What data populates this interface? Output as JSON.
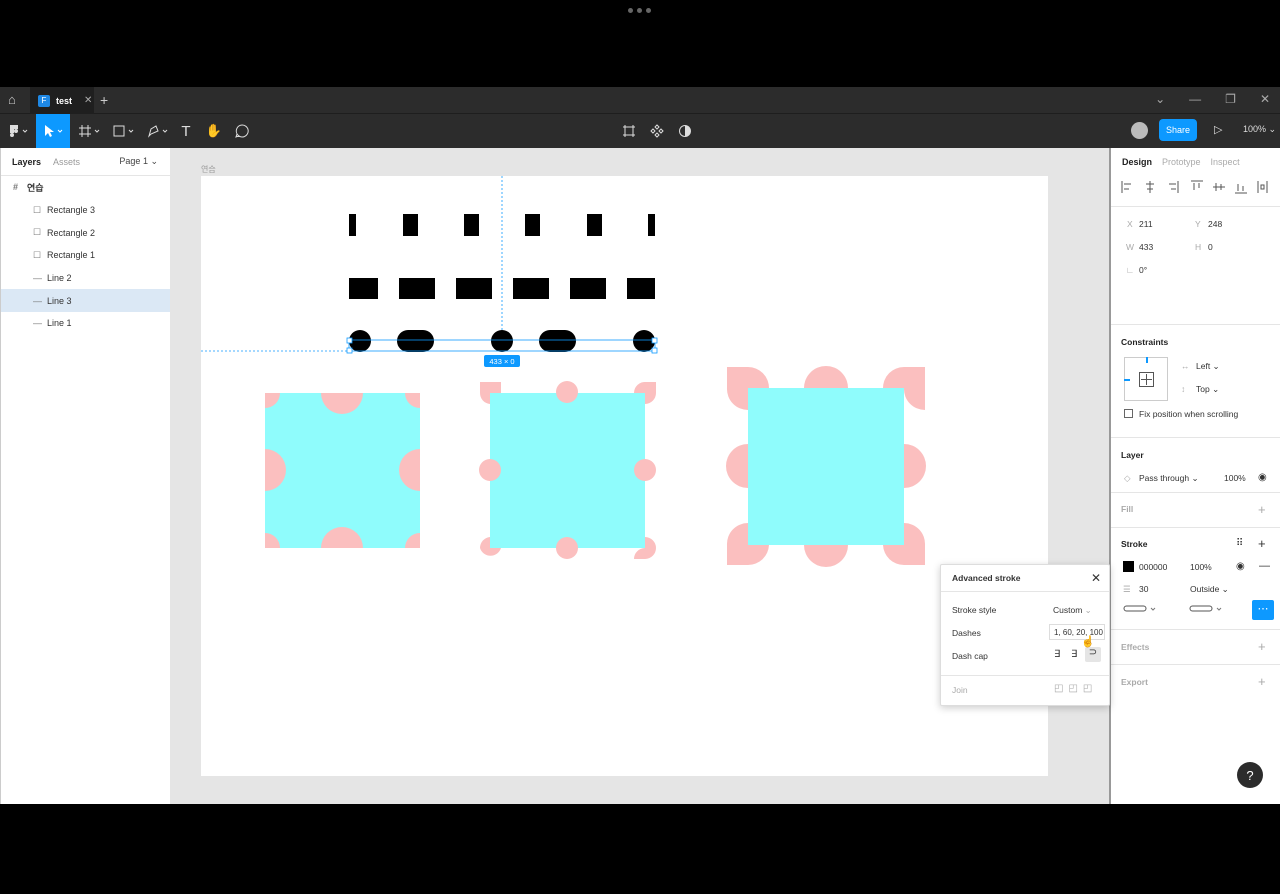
{
  "tabbar": {
    "file_name": "test",
    "file_icon_label": "F"
  },
  "toolbar": {
    "share_label": "Share",
    "zoom_label": "100%"
  },
  "left_panel": {
    "tab_layers": "Layers",
    "tab_assets": "Assets",
    "page_label": "Page 1",
    "frame_name": "연습",
    "layers": [
      {
        "name": "Rectangle 3",
        "icon": "rectangle-icon"
      },
      {
        "name": "Rectangle 2",
        "icon": "rectangle-icon"
      },
      {
        "name": "Rectangle 1",
        "icon": "rectangle-icon"
      },
      {
        "name": "Line 2",
        "icon": "line-icon"
      },
      {
        "name": "Line 3",
        "icon": "line-icon",
        "selected": true
      },
      {
        "name": "Line 1",
        "icon": "line-icon"
      }
    ]
  },
  "canvas": {
    "frame_label": "연습",
    "size_badge": "433 × 0"
  },
  "right_panel": {
    "tab_design": "Design",
    "tab_prototype": "Prototype",
    "tab_inspect": "Inspect",
    "x_label": "X",
    "x_value": "211",
    "y_label": "Y",
    "y_value": "248",
    "w_label": "W",
    "w_value": "433",
    "h_label": "H",
    "h_value": "0",
    "rotation_value": "0°",
    "constraints_title": "Constraints",
    "constraint_h": "Left",
    "constraint_v": "Top",
    "fix_position_label": "Fix position when scrolling",
    "layer_title": "Layer",
    "blend_mode": "Pass through",
    "layer_opacity": "100%",
    "fill_title": "Fill",
    "stroke_title": "Stroke",
    "stroke_color_hex": "000000",
    "stroke_opacity": "100%",
    "stroke_weight": "30",
    "stroke_position": "Outside",
    "effects_title": "Effects",
    "export_title": "Export"
  },
  "advanced_stroke": {
    "title": "Advanced stroke",
    "stroke_style_label": "Stroke style",
    "stroke_style_value": "Custom",
    "dashes_label": "Dashes",
    "dashes_value": "1, 60, 20, 100",
    "dash_cap_label": "Dash cap",
    "join_label": "Join"
  },
  "help_label": "?",
  "colors": {
    "accent": "#0d99ff",
    "cyan_fill": "#8ffcfc",
    "pink_stroke": "#fbbfbf"
  }
}
